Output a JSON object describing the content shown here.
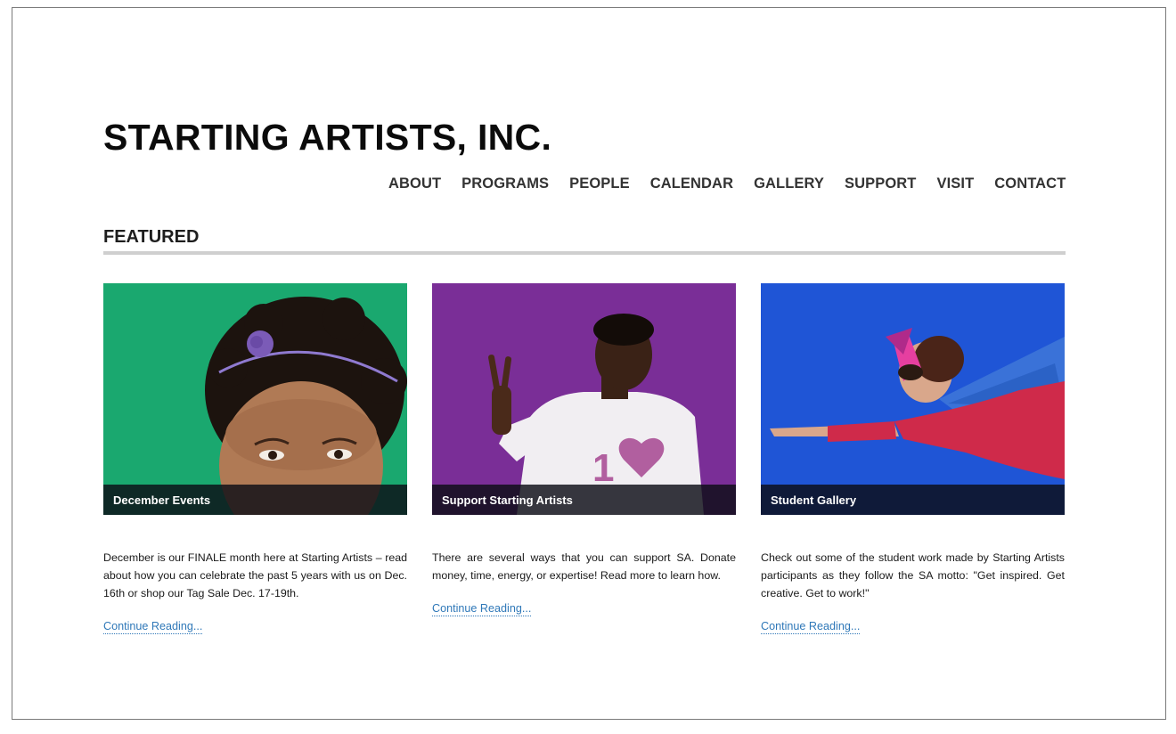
{
  "site": {
    "title": "STARTING ARTISTS, INC."
  },
  "nav": {
    "items": [
      "ABOUT",
      "PROGRAMS",
      "PEOPLE",
      "CALENDAR",
      "GALLERY",
      "SUPPORT",
      "VISIT",
      "CONTACT"
    ]
  },
  "featured": {
    "heading": "FEATURED",
    "cards": [
      {
        "caption": "December Events",
        "image_bg": "#1aa86f",
        "text": "December is our FINALE month here at Starting Artists – read about how you can celebrate the past 5 years with us on Dec. 16th or shop our Tag Sale Dec. 17-19th.",
        "link": "Continue Reading..."
      },
      {
        "caption": "Support Starting Artists",
        "image_bg": "#7a2e97",
        "text": "There are several ways that you can support SA. Donate money, time, energy, or expertise! Read more to learn how.",
        "link": "Continue Reading..."
      },
      {
        "caption": "Student Gallery",
        "image_bg": "#1f55d6",
        "text": "Check out some of the student work made by Starting Artists participants as they follow the SA motto: \"Get inspired. Get creative. Get to work!\"",
        "link": "Continue Reading..."
      }
    ]
  },
  "colors": {
    "link": "#2f78b8",
    "rule": "#cfcfcf"
  }
}
